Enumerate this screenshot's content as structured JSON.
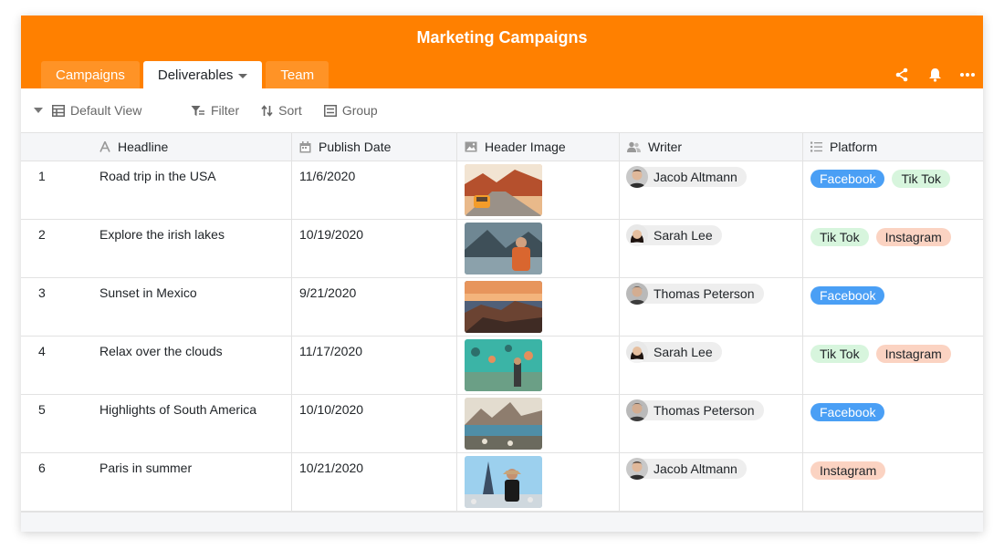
{
  "app": {
    "title": "Marketing Campaigns",
    "accent": "#ff8000"
  },
  "tabs": [
    {
      "label": "Campaigns",
      "active": false
    },
    {
      "label": "Deliverables",
      "active": true
    },
    {
      "label": "Team",
      "active": false
    }
  ],
  "header_icons": [
    "share-icon",
    "bell-icon",
    "more-icon"
  ],
  "toolbar": {
    "view_label": "Default View",
    "filter_label": "Filter",
    "sort_label": "Sort",
    "group_label": "Group"
  },
  "columns": {
    "headline": "Headline",
    "publish_date": "Publish Date",
    "header_image": "Header Image",
    "writer": "Writer",
    "platform": "Platform"
  },
  "tag_colors": {
    "Facebook": {
      "bg": "#4a9ff5",
      "fg": "#ffffff"
    },
    "Tik Tok": {
      "bg": "#d7f5dd",
      "fg": "#212529"
    },
    "Instagram": {
      "bg": "#fbd3c2",
      "fg": "#212529"
    }
  },
  "rows": [
    {
      "index": "1",
      "headline": "Road trip in the USA",
      "date": "11/6/2020",
      "image": "desert-road-van",
      "writer": "Jacob Altmann",
      "avatar": "man-dark-hair",
      "platforms": [
        "Facebook",
        "Tik Tok"
      ]
    },
    {
      "index": "2",
      "headline": "Explore the irish lakes",
      "date": "10/19/2020",
      "image": "hiker-lake",
      "writer": "Sarah Lee",
      "avatar": "woman-dark-hair",
      "platforms": [
        "Tik Tok",
        "Instagram"
      ]
    },
    {
      "index": "3",
      "headline": "Sunset in Mexico",
      "date": "9/21/2020",
      "image": "coast-sunset",
      "writer": "Thomas Peterson",
      "avatar": "man-grey",
      "platforms": [
        "Facebook"
      ]
    },
    {
      "index": "4",
      "headline": "Relax over the clouds",
      "date": "11/17/2020",
      "image": "balloons-teal",
      "writer": "Sarah Lee",
      "avatar": "woman-dark-hair",
      "platforms": [
        "Tik Tok",
        "Instagram"
      ]
    },
    {
      "index": "5",
      "headline": "Highlights of South America",
      "date": "10/10/2020",
      "image": "rio-bay",
      "writer": "Thomas Peterson",
      "avatar": "man-grey",
      "platforms": [
        "Facebook"
      ]
    },
    {
      "index": "6",
      "headline": "Paris in summer",
      "date": "10/21/2020",
      "image": "eiffel-tower",
      "writer": "Jacob Altmann",
      "avatar": "man-dark-hair",
      "platforms": [
        "Instagram"
      ]
    }
  ]
}
